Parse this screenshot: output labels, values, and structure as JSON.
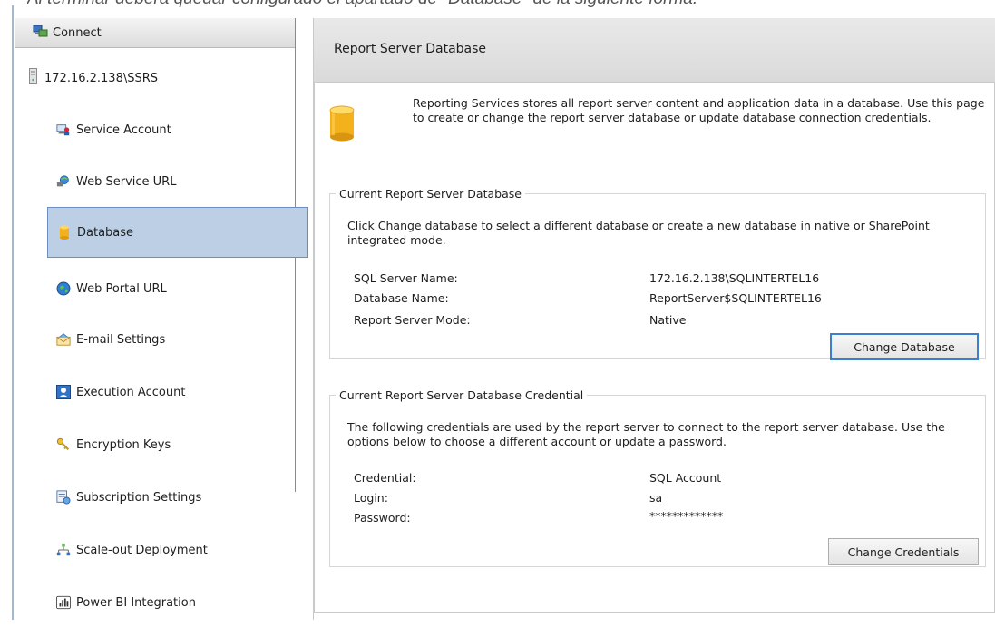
{
  "caption": "Al terminar deberá quedar configurado el apartado de \"Database\" de la siguiente forma:",
  "sidebar": {
    "connect_label": "Connect",
    "server": "172.16.2.138\\SSRS",
    "items": [
      {
        "label": "Service Account",
        "icon": "service-account-icon"
      },
      {
        "label": "Web Service URL",
        "icon": "web-service-icon"
      },
      {
        "label": "Database",
        "icon": "database-icon",
        "selected": true
      },
      {
        "label": "Web Portal URL",
        "icon": "globe-icon"
      },
      {
        "label": "E-mail Settings",
        "icon": "email-icon"
      },
      {
        "label": "Execution Account",
        "icon": "execution-account-icon"
      },
      {
        "label": "Encryption Keys",
        "icon": "keys-icon"
      },
      {
        "label": "Subscription Settings",
        "icon": "subscription-icon"
      },
      {
        "label": "Scale-out Deployment",
        "icon": "scale-out-icon"
      },
      {
        "label": "Power BI Integration",
        "icon": "power-bi-icon"
      }
    ]
  },
  "main": {
    "title": "Report Server Database",
    "intro": "Reporting Services stores all report server content and application data in a database. Use this page to create or change the report server database or update database connection credentials.",
    "current_db": {
      "legend": "Current Report Server Database",
      "description": "Click Change database to select a different database or create a new database in native or SharePoint integrated mode.",
      "rows": [
        {
          "label": "SQL Server Name:",
          "value": "172.16.2.138\\SQLINTERTEL16"
        },
        {
          "label": "Database Name:",
          "value": "ReportServer$SQLINTERTEL16"
        },
        {
          "label": "Report Server Mode:",
          "value": "Native"
        }
      ],
      "button": "Change Database"
    },
    "credential": {
      "legend": "Current Report Server Database Credential",
      "description": "The following credentials are used by the report server to connect to the report server database. Use the options below to choose a different account or update a password.",
      "rows": [
        {
          "label": "Credential:",
          "value": "SQL Account"
        },
        {
          "label": "Login:",
          "value": "sa"
        },
        {
          "label": "Password:",
          "value": "*************"
        }
      ],
      "button": "Change Credentials"
    }
  },
  "colors": {
    "selected_bg": "#bccfe5",
    "selected_border": "#6b8fbd",
    "primary_button_border": "#3c7fd1"
  }
}
